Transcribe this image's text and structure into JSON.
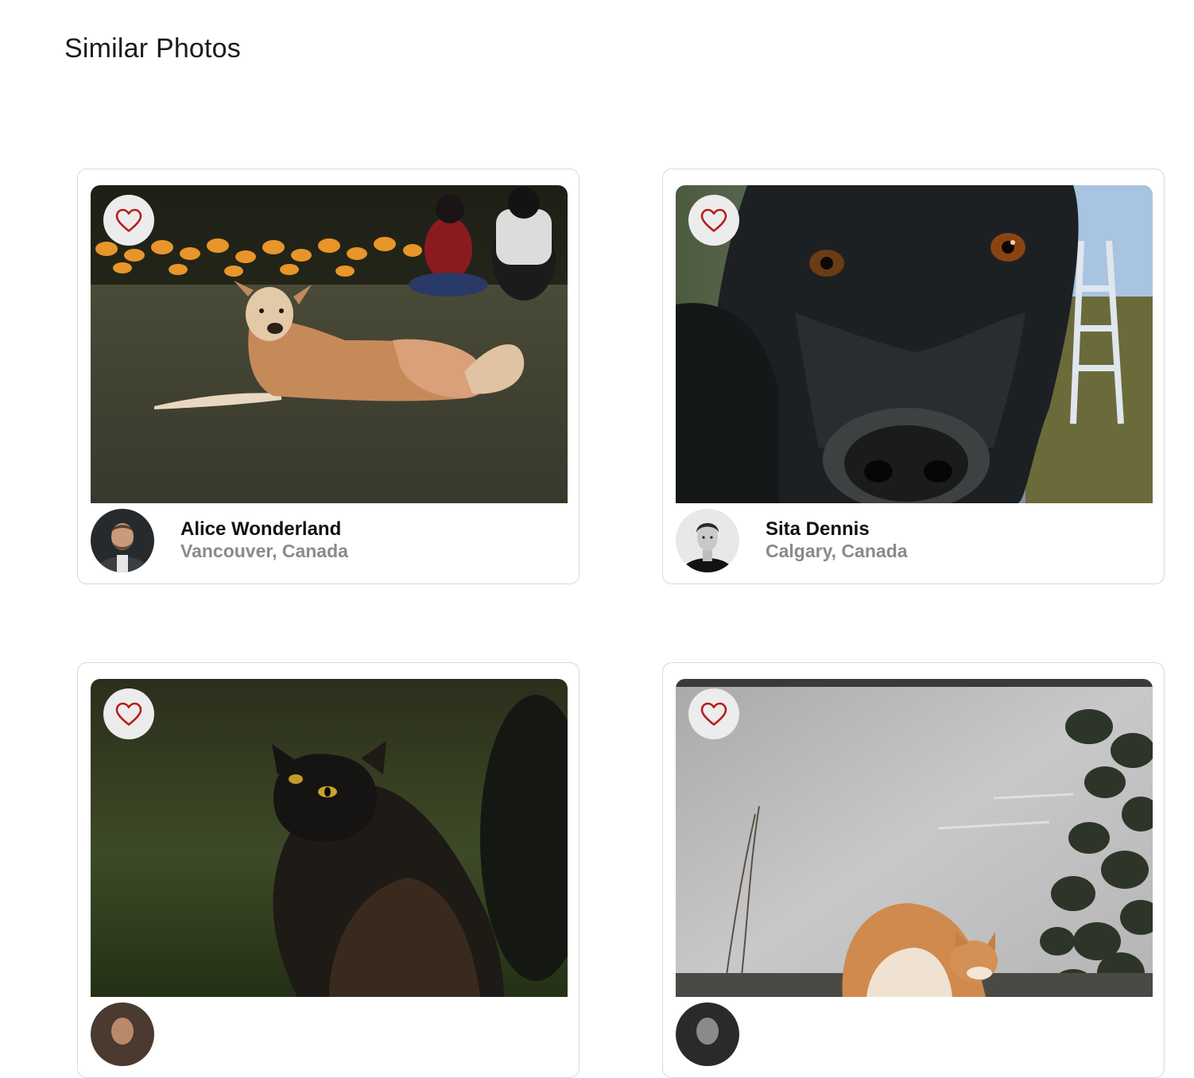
{
  "page": {
    "title": "Similar Photos"
  },
  "colors": {
    "heart": "#b71c1c",
    "favorite_bg": "#ececec",
    "location_text": "#8a8a8a",
    "card_border": "#d9d9d9"
  },
  "icons": {
    "favorite": "heart-outline-icon"
  },
  "photos": [
    {
      "subject": "dog-lying-on-grass",
      "author": {
        "name": "Alice Wonderland",
        "location": "Vancouver, Canada"
      }
    },
    {
      "subject": "black-dog-closeup",
      "author": {
        "name": "Sita Dennis",
        "location": "Calgary, Canada"
      }
    },
    {
      "subject": "black-cat-looking-up",
      "author": {
        "name": "",
        "location": ""
      }
    },
    {
      "subject": "orange-cat-by-wall",
      "author": {
        "name": "",
        "location": ""
      }
    }
  ]
}
